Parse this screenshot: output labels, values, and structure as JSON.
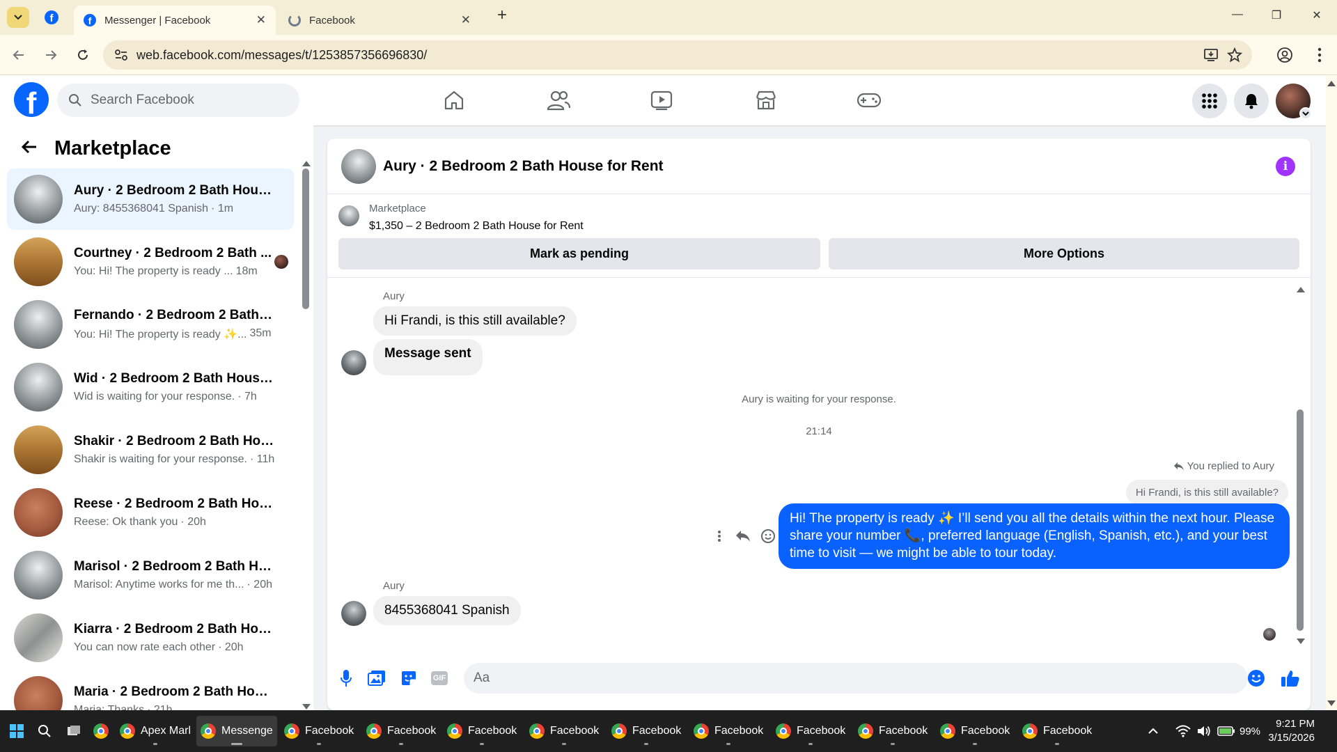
{
  "browser": {
    "tabs": [
      {
        "title": "Messenger | Facebook",
        "active": true
      },
      {
        "title": "Facebook",
        "active": false
      }
    ],
    "url": "web.facebook.com/messages/t/1253857356696830/"
  },
  "header": {
    "search_placeholder": "Search Facebook"
  },
  "sidebar": {
    "title": "Marketplace",
    "conversations": [
      {
        "name": "Aury · 2 Bedroom 2 Bath House ...",
        "preview": "Aury: 8455368041 Spanish",
        "time": "· 1m",
        "thumb": "room",
        "selected": true
      },
      {
        "name": "Courtney · 2 Bedroom 2 Bath ...",
        "preview": "You: Hi! The property is ready ...",
        "time": "18m",
        "thumb": "wood",
        "selected": false
      },
      {
        "name": "Fernando · 2 Bedroom 2 Bath H...",
        "preview": "You: Hi! The property is ready ✨...",
        "time": "35m",
        "thumb": "room",
        "selected": false
      },
      {
        "name": "Wid · 2 Bedroom 2 Bath House f...",
        "preview": "Wid is waiting for your response.",
        "time": "· 7h",
        "thumb": "room",
        "selected": false
      },
      {
        "name": "Shakir · 2 Bedroom 2 Bath Hous...",
        "preview": "Shakir is waiting for your response.",
        "time": "· 11h",
        "thumb": "wood",
        "selected": false
      },
      {
        "name": "Reese · 2 Bedroom 2 Bath Hous...",
        "preview": "Reese: Ok thank you",
        "time": "· 20h",
        "thumb": "skin",
        "selected": false
      },
      {
        "name": "Marisol · 2 Bedroom 2 Bath Hou...",
        "preview": "Marisol: Anytime works for me th...",
        "time": "· 20h",
        "thumb": "room",
        "selected": false
      },
      {
        "name": "Kiarra · 2 Bedroom 2 Bath Hous...",
        "preview": "You can now rate each other",
        "time": "· 20h",
        "thumb": "kitchen",
        "selected": false
      },
      {
        "name": "Maria · 2 Bedroom 2 Bath Hous...",
        "preview": "Maria: Thanks",
        "time": "· 21h",
        "thumb": "skin",
        "selected": false
      }
    ]
  },
  "chat": {
    "title": "Aury · 2 Bedroom 2 Bath House for Rent",
    "marketplace_label": "Marketplace",
    "listing": "$1,350 – 2 Bedroom 2 Bath House for Rent",
    "mark_pending": "Mark as pending",
    "more_options": "More Options",
    "sender_name": "Aury",
    "msg1": "Hi Frandi, is this still available?",
    "msg2": "Message sent",
    "waiting": "Aury is waiting for your response.",
    "timestamp": "21:14",
    "replied_label": "You replied to Aury",
    "quoted": "Hi Frandi, is this still available?",
    "outgoing": "Hi! The property is ready ✨ I’ll send you all the details within the next hour. Please share your number 📞, preferred language (English, Spanish, etc.), and your best time to visit — we might be able to tour today.",
    "sender_name2": "Aury",
    "msg3": "8455368041 Spanish",
    "composer_placeholder": "Aa"
  },
  "taskbar": {
    "items": [
      "Apex Marl",
      "Messenge",
      "Facebook",
      "Facebook",
      "Facebook",
      "Facebook",
      "Facebook",
      "Facebook",
      "Facebook",
      "Facebook",
      "Facebook",
      "Facebook"
    ],
    "battery": "99%",
    "time": "9:21 PM",
    "date": "3/15/2026"
  },
  "colors": {
    "facebook_blue": "#0866ff",
    "outgoing_bubble": "#0a62fe",
    "info_purple": "#a033ff",
    "selected_row": "#ebf5ff"
  }
}
